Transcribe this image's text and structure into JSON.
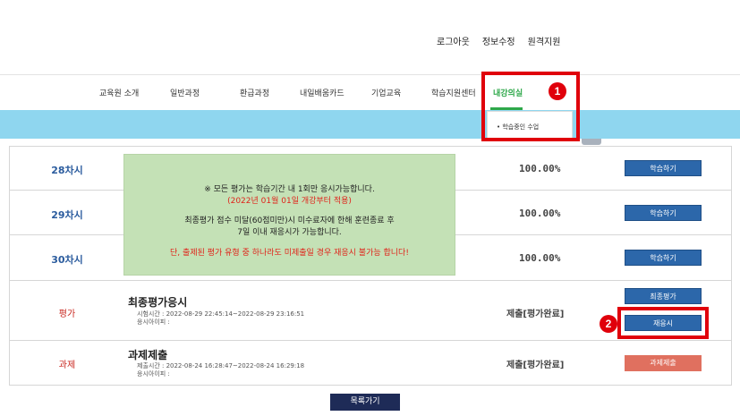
{
  "header": {
    "links": [
      "로그아웃",
      "정보수정",
      "원격지원"
    ]
  },
  "nav": {
    "items": [
      "교육원 소개",
      "일반과정",
      "환급과정",
      "내일배움카드",
      "기업교육",
      "학습지원센터",
      "내강의실"
    ],
    "active": "내강의실",
    "dropdown_item": "• 학습중인 수업"
  },
  "annotations": {
    "marker1": "1",
    "marker2": "2"
  },
  "sessions": [
    {
      "label": "28차시",
      "progress": "100.00%",
      "button": "학습하기"
    },
    {
      "label": "29차시",
      "progress": "100.00%",
      "button": "학습하기"
    },
    {
      "label": "30차시",
      "progress": "100.00%",
      "button": "학습하기"
    }
  ],
  "notice": {
    "line1": "※ 모든 평가는 학습기간 내 1회만 응시가능합니다.",
    "line2": "(2022년 01월 01일 개강부터 적용)",
    "line3": "최종평가 점수 미달(60점미만)시 미수료자에 한해 훈련종료 후",
    "line4": "7일 이내 재응시가 가능합니다.",
    "line5": "단, 출제된 평가 유형 중 하나라도 미제출일 경우 재응시 불가능 합니다!"
  },
  "exam": {
    "type_label": "평가",
    "title": "최종평가응시",
    "time": "시험시간 : 2022-08-29 22:45:14~2022-08-29 23:16:51",
    "ip": "응시아이피 :",
    "status": "제출[평가완료]",
    "btn_final": "최종평가",
    "btn_retake": "재응시"
  },
  "assignment": {
    "type_label": "과제",
    "title": "과제제출",
    "time": "제출시간 : 2022-08-24 16:28:47~2022-08-24 16:29:18",
    "ip": "응시아이피 :",
    "status": "제출[평가완료]",
    "button": "과제제출"
  },
  "footer": {
    "list_button": "목록가기"
  },
  "colors": {
    "accent_green": "#2ea84a",
    "banner": "#8fd6ef",
    "button_blue": "#2c67aa",
    "marker_red": "#e0000b"
  }
}
